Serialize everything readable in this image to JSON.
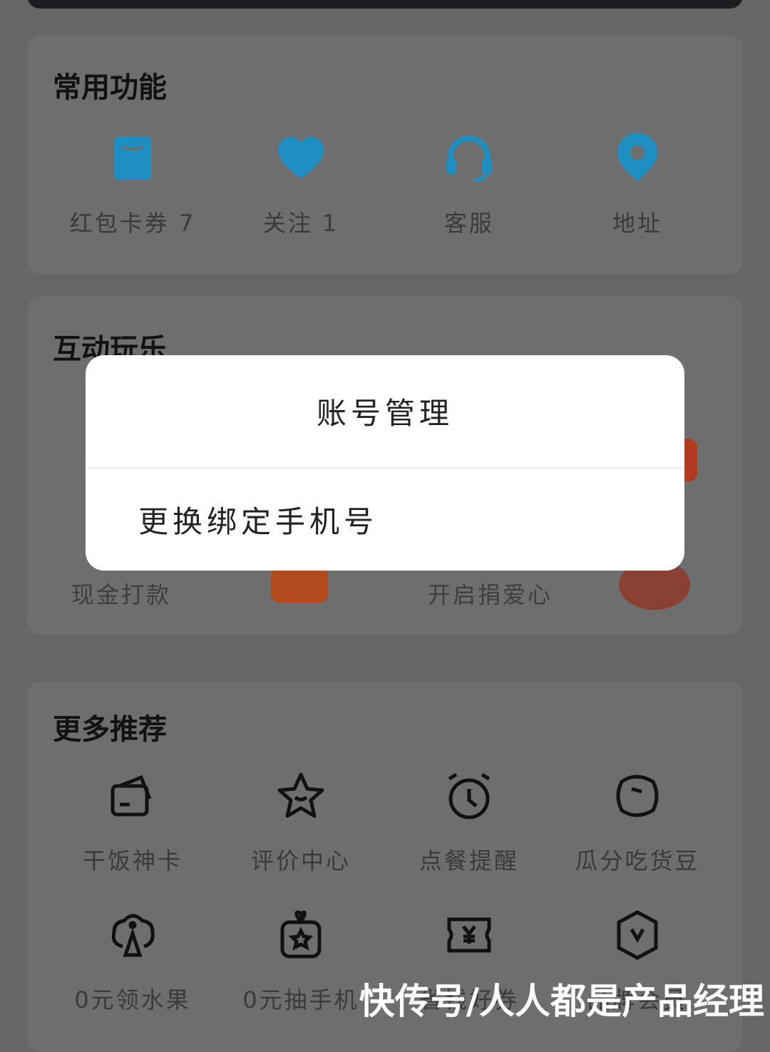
{
  "common": {
    "title": "常用功能",
    "items": [
      {
        "label": "红包卡券 7",
        "icon": "coupon-icon"
      },
      {
        "label": "关注 1",
        "icon": "heart-icon"
      },
      {
        "label": "客服",
        "icon": "headset-icon"
      },
      {
        "label": "地址",
        "icon": "location-pin-icon"
      }
    ]
  },
  "interactive": {
    "title": "互动玩乐",
    "items": [
      {
        "subtitle": "现金打款"
      },
      {
        "subtitle": "开启捐爱心"
      }
    ]
  },
  "more": {
    "title": "更多推荐",
    "items": [
      {
        "label": "干饭神卡",
        "icon": "card-icon"
      },
      {
        "label": "评价中心",
        "icon": "star-icon"
      },
      {
        "label": "点餐提醒",
        "icon": "alarm-clock-icon"
      },
      {
        "label": "瓜分吃货豆",
        "icon": "bean-icon"
      },
      {
        "label": "0元领水果",
        "icon": "tree-icon"
      },
      {
        "label": "0元抽手机",
        "icon": "gift-box-icon"
      },
      {
        "label": "省钱好券",
        "icon": "yuan-ticket-icon"
      },
      {
        "label": "品牌会员",
        "icon": "vip-icon"
      }
    ]
  },
  "modal": {
    "title": "账号管理",
    "option": "更换绑定手机号"
  },
  "watermark": "快传号/人人都是产品经理",
  "colors": {
    "accent": "#1e8fc0",
    "overlay": "#666666"
  }
}
